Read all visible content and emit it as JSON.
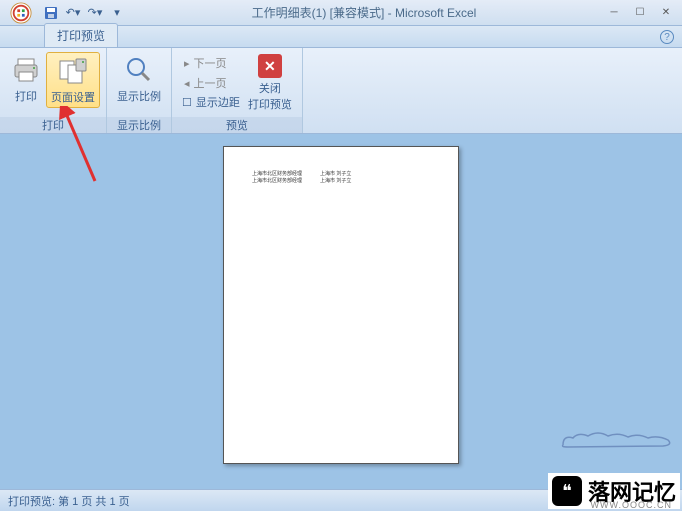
{
  "titlebar": {
    "title": "工作明细表(1)  [兼容模式] - Microsoft Excel"
  },
  "tabs": {
    "active": "打印预览"
  },
  "ribbon": {
    "print_group": {
      "label": "打印",
      "print_btn": "打印",
      "page_setup_btn": "页面设置"
    },
    "zoom_group": {
      "label": "显示比例",
      "zoom_btn": "显示比例"
    },
    "preview_group": {
      "label": "预览",
      "next_page": "下一页",
      "prev_page": "上一页",
      "show_margins": "显示边距",
      "close_btn_l1": "关闭",
      "close_btn_l2": "打印预览"
    }
  },
  "page_content": {
    "row1_col1": "上海市北区财务部经理",
    "row1_col2": "上海市 刘子立",
    "row2_col1": "上海市北区财务部经理",
    "row2_col2": "上海市 刘子立"
  },
  "statusbar": {
    "text": "打印预览: 第 1 页 共 1 页"
  },
  "watermark": {
    "text": "落网记忆",
    "url": "WWW.OOOC.CN"
  }
}
